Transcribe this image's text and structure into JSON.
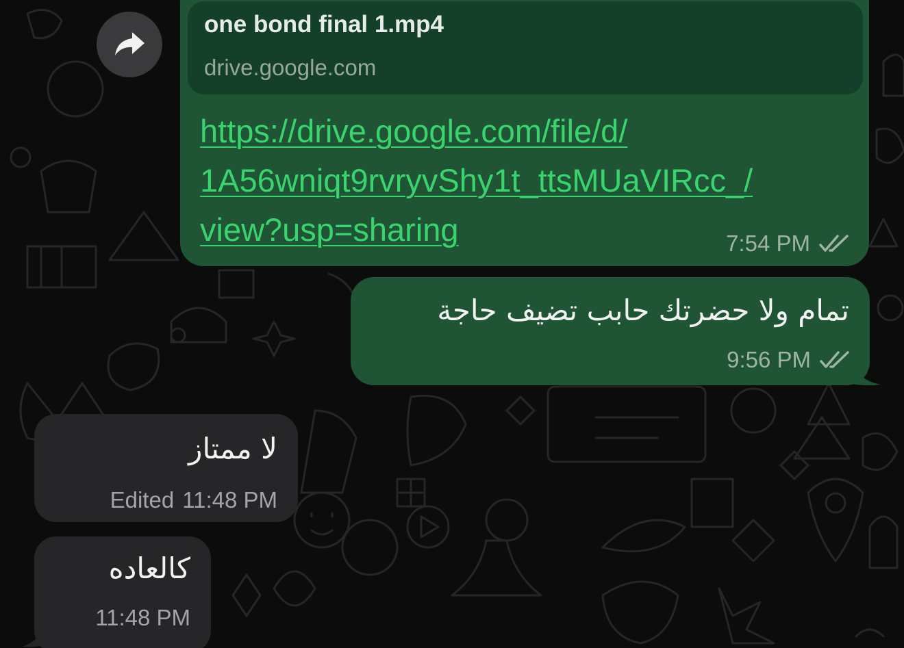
{
  "messages": [
    {
      "direction": "outgoing",
      "link_preview": {
        "title": "one bond final 1.mp4",
        "domain": "drive.google.com"
      },
      "link_lines": [
        "https://drive.google.com/file/d/",
        "1A56wniqt9rvryvShy1t_ttsMUaVIRcc_/",
        "view?usp=sharing"
      ],
      "time": "7:54 PM",
      "status_icon": "double-check-icon"
    },
    {
      "direction": "outgoing",
      "text": "تمام ولا حضرتك حابب تضيف حاجة",
      "time": "9:56 PM",
      "status_icon": "double-check-icon"
    },
    {
      "direction": "incoming",
      "text": "لا ممتاز",
      "edited_label": "Edited",
      "time": "11:48 PM"
    },
    {
      "direction": "incoming",
      "text": "كالعاده",
      "time": "11:48 PM"
    }
  ],
  "forward_button": {
    "icon": "forward-arrow-icon"
  },
  "colors": {
    "background": "#0c0c0c",
    "outgoing_bubble": "#1f5535",
    "link_preview_bg": "#14402a",
    "link_text": "#3ad46f",
    "incoming_bubble": "#262628",
    "meta_text": "#9fb3a6"
  }
}
